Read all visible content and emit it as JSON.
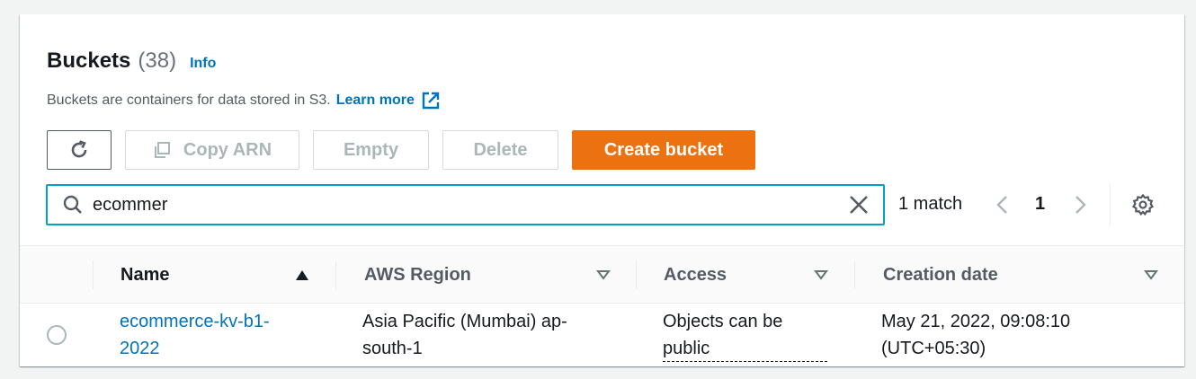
{
  "header": {
    "title": "Buckets",
    "count": "(38)",
    "info_label": "Info",
    "description": "Buckets are containers for data stored in S3.",
    "learn_more": "Learn more"
  },
  "toolbar": {
    "copy_arn_label": "Copy ARN",
    "empty_label": "Empty",
    "delete_label": "Delete",
    "create_label": "Create bucket"
  },
  "search": {
    "value": "ecommer",
    "match_text": "1 match",
    "page": "1"
  },
  "table": {
    "columns": [
      "Name",
      "AWS Region",
      "Access",
      "Creation date"
    ],
    "rows": [
      {
        "name_line1": "ecommerce-kv-b1-",
        "name_line2": "2022",
        "region_line1": "Asia Pacific (Mumbai) ap-",
        "region_line2": "south-1",
        "access_line1": "Objects can be",
        "access_line2": "public",
        "date_line1": "May 21, 2022, 09:08:10",
        "date_line2": "(UTC+05:30)"
      }
    ]
  },
  "colors": {
    "primary": "#ec7211",
    "link": "#0073bb",
    "focus": "#00a1c9"
  }
}
